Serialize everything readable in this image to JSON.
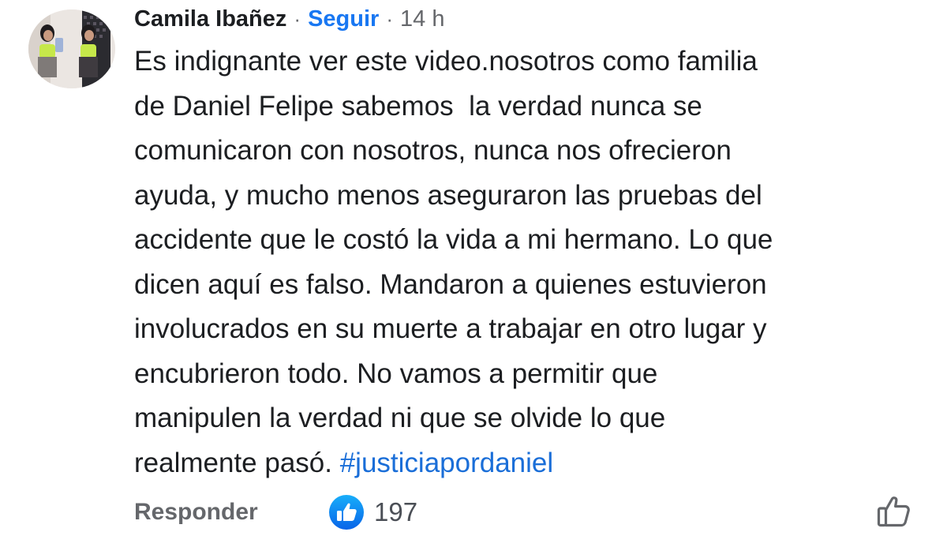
{
  "comment": {
    "author": "Camila Ibañez",
    "separator": "·",
    "follow_label": "Seguir",
    "timestamp": "14 h",
    "body_lines": [
      "Es indignante ver este video.nosotros como familia",
      "de Daniel Felipe sabemos  la verdad nunca se",
      "comunicaron con nosotros, nunca nos ofrecieron",
      "ayuda, y mucho menos aseguraron las pruebas del",
      "accidente que le costó la vida a mi hermano. Lo que",
      "dicen aquí es falso. Mandaron a quienes estuvieron",
      "involucrados en su muerte a trabajar en otro lugar y",
      "encubrieron todo. No vamos a permitir que",
      "manipulen la verdad ni que se olvide lo que",
      "realmente pasó. "
    ],
    "hashtag": "#justiciapordaniel",
    "reply_label": "Responder",
    "reaction_icon": "like-icon",
    "like_count": "197",
    "like_button_icon": "thumbs-up-outline-icon"
  },
  "colors": {
    "link_blue": "#1877f2",
    "hashtag_blue": "#1a6ed8",
    "muted_gray": "#65676b",
    "text": "#1c1e21",
    "avatar_top_color": "#c6e84a"
  }
}
